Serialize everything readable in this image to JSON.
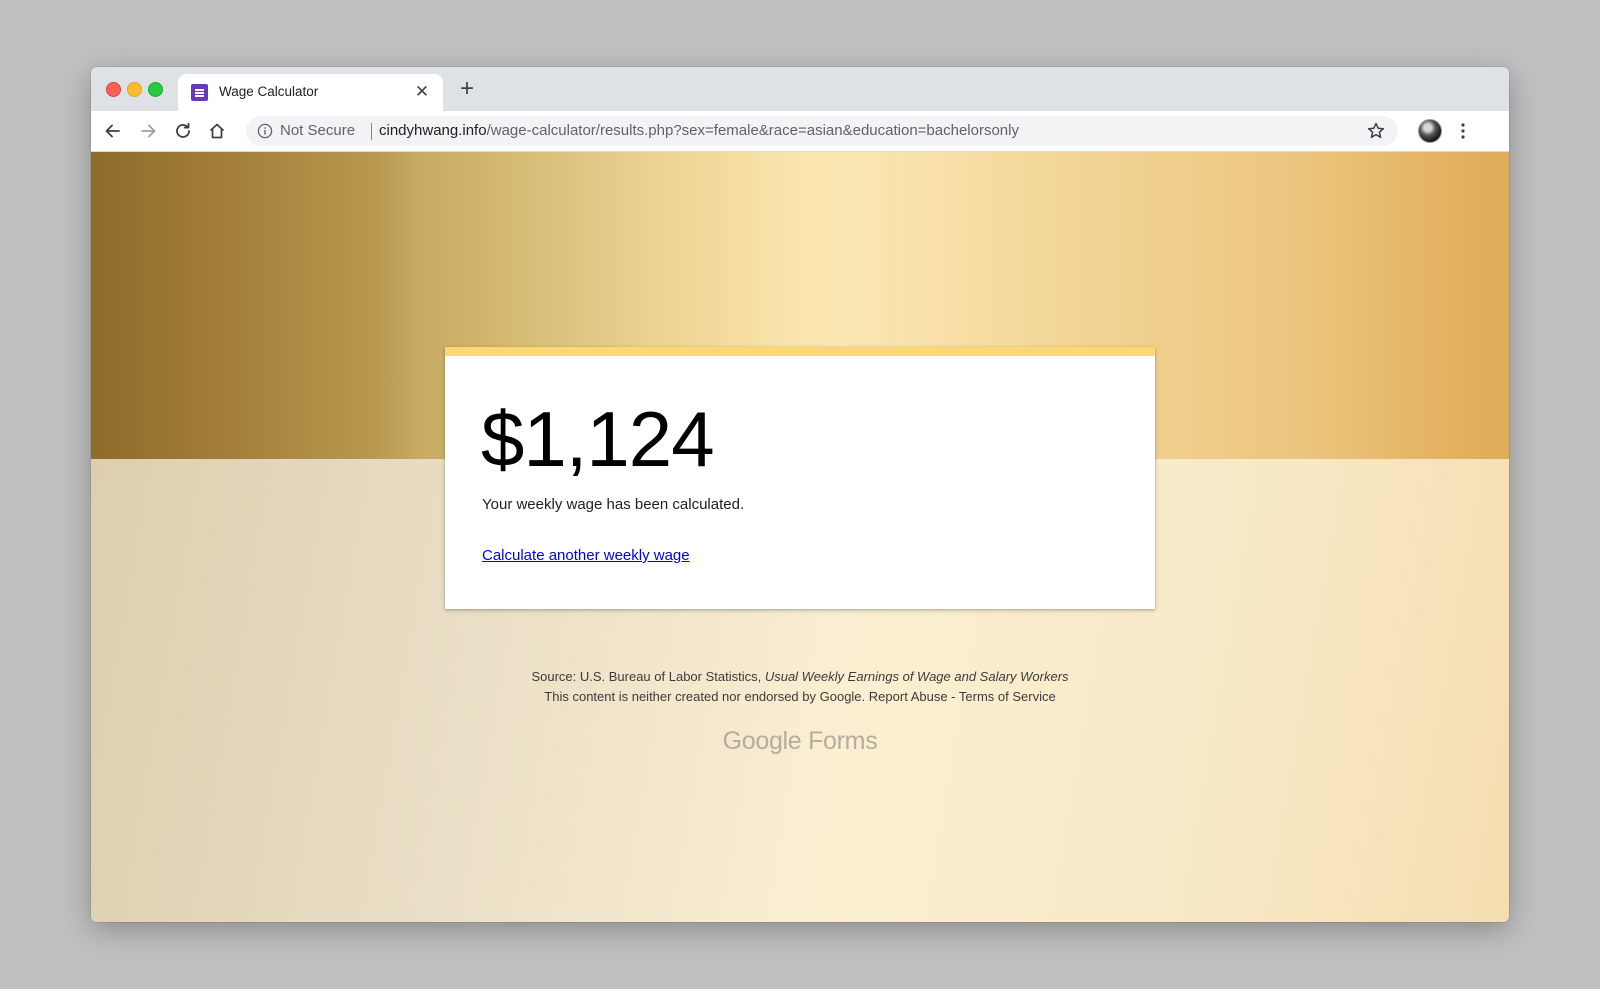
{
  "browser": {
    "tab": {
      "title": "Wage Calculator",
      "favicon": "google-forms-icon",
      "close_glyph": "✕"
    },
    "new_tab_glyph": "+",
    "address": {
      "security_label": "Not Secure",
      "url_host": "cindyhwang.info",
      "url_path": "/wage-calculator/results.php?sex=female&race=asian&education=bachelorsonly"
    },
    "icons": [
      "back-arrow-icon",
      "forward-arrow-icon",
      "reload-icon",
      "home-icon",
      "info-icon",
      "star-icon",
      "avatar",
      "more-vert-icon"
    ]
  },
  "result": {
    "amount": "$1,124",
    "message": "Your weekly wage has been calculated.",
    "link_label": "Calculate another weekly wage"
  },
  "footer": {
    "source_prefix": "Source: U.S. Bureau of Labor Statistics, ",
    "source_title": "Usual Weekly Earnings of Wage and Salary Workers",
    "note": "This content is neither created nor endorsed by Google.",
    "report_abuse": "Report Abuse",
    "separator": " - ",
    "terms": "Terms of Service"
  },
  "branding": {
    "google": "Google",
    "forms": "Forms"
  },
  "colors": {
    "accent": "#fcd873",
    "favicon": "#673ab7",
    "link": "#0000ee"
  }
}
